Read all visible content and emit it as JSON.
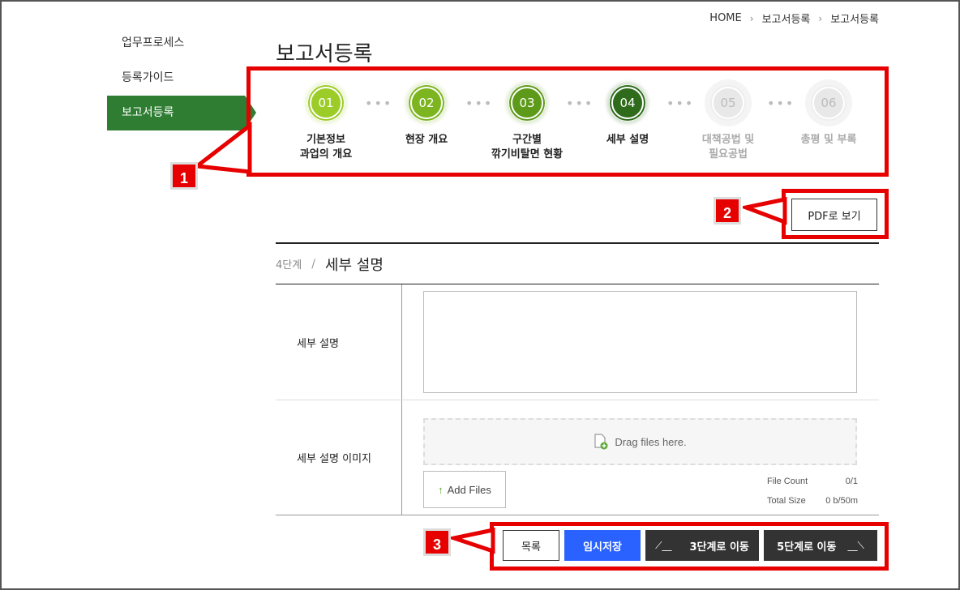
{
  "breadcrumb": {
    "home": "HOME",
    "level1": "보고서등록",
    "level2": "보고서등록"
  },
  "sidebar": {
    "items": [
      {
        "label": "업무프로세스"
      },
      {
        "label": "등록가이드"
      },
      {
        "label": "보고서등록"
      }
    ]
  },
  "page_title": "보고서등록",
  "steps": [
    {
      "num": "01",
      "label": "기본정보\n과업의 개요",
      "color": "#9ccc28",
      "state": "done"
    },
    {
      "num": "02",
      "label": "현장 개요",
      "color": "#7cb51f",
      "state": "done"
    },
    {
      "num": "03",
      "label": "구간별\n깎기비탈면 현황",
      "color": "#5e9a1a",
      "state": "done"
    },
    {
      "num": "04",
      "label": "세부 설명",
      "color": "#2e6b1a",
      "state": "current"
    },
    {
      "num": "05",
      "label": "대책공법 및\n필요공법",
      "color": "#e8e8e8",
      "state": "inactive"
    },
    {
      "num": "06",
      "label": "총평 및 부록",
      "color": "#e8e8e8",
      "state": "inactive"
    }
  ],
  "pdf_button": "PDF로 보기",
  "section": {
    "stage": "4단계",
    "name": "세부 설명"
  },
  "form": {
    "desc_label": "세부 설명",
    "image_label": "세부 설명 이미지",
    "dropzone_text": "Drag files here.",
    "add_files": "Add Files",
    "file_count_label": "File Count",
    "file_count_value": "0/1",
    "total_size_label": "Total Size",
    "total_size_value": "0 b/50m"
  },
  "buttons": {
    "list": "목록",
    "save": "임시저장",
    "prev": "3단계로 이동",
    "next": "5단계로 이동"
  },
  "annotations": {
    "one": "1",
    "two": "2",
    "three": "3"
  },
  "colors": {
    "accent_green": "#2e7d32",
    "highlight_red": "#e60000",
    "save_blue": "#2962ff"
  }
}
